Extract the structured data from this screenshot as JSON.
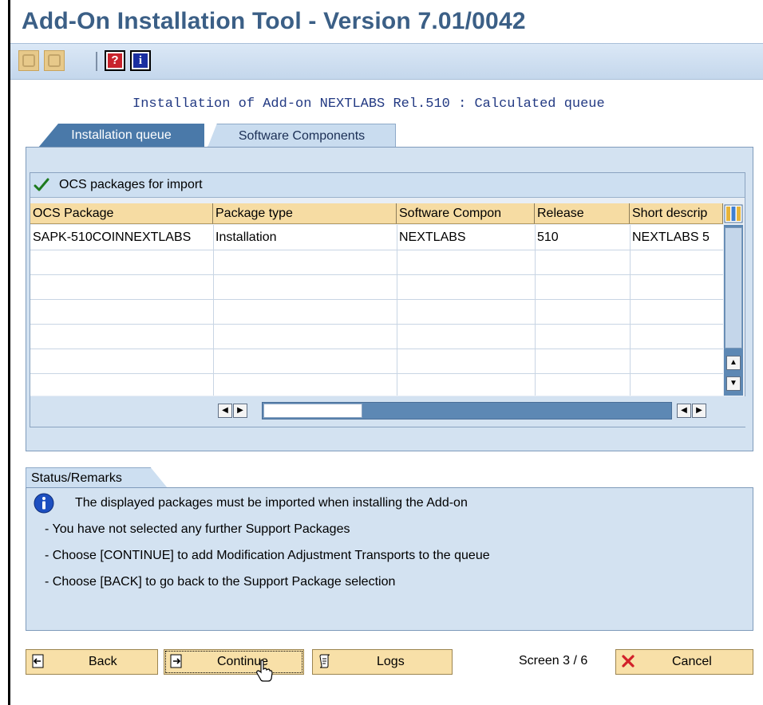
{
  "window": {
    "title": "Add-On Installation Tool - Version 7.01/0042"
  },
  "toolbar": {
    "buttons": [
      {
        "icon": "disabled-tool-icon",
        "enabled": false
      },
      {
        "icon": "disabled-tool-icon",
        "enabled": false
      },
      {
        "icon": "help-icon",
        "glyph": "?",
        "enabled": true
      },
      {
        "icon": "info-icon",
        "glyph": "i",
        "enabled": true
      }
    ]
  },
  "queue_title": "Installation of Add-on NEXTLABS Rel.510 : Calculated queue",
  "tabs": [
    {
      "label": "Installation queue",
      "active": true
    },
    {
      "label": "Software Components",
      "active": false
    }
  ],
  "grid": {
    "title": "OCS packages for import",
    "columns": [
      "OCS Package",
      "Package type",
      "Software Compon",
      "Release",
      "Short descrip"
    ],
    "rows": [
      [
        "SAPK-510COINNEXTLABS",
        "Installation",
        "NEXTLABS",
        "510",
        "NEXTLABS 5"
      ]
    ],
    "empty_rows": 6,
    "accent": "#5d88b4",
    "header_color": "#f6dca3"
  },
  "status": {
    "tab_label": "Status/Remarks",
    "headline": "The displayed packages must be imported when installing the Add-on",
    "lines": [
      "- You have not selected any further Support Packages",
      "- Choose [CONTINUE] to add Modification Adjustment Transports to the queue",
      "- Choose [BACK] to go back to the Support Package selection"
    ]
  },
  "footer": {
    "back_label": "Back",
    "continue_label": "Continue",
    "logs_label": "Logs",
    "screen_label": "Screen 3 / 6",
    "cancel_label": "Cancel"
  }
}
